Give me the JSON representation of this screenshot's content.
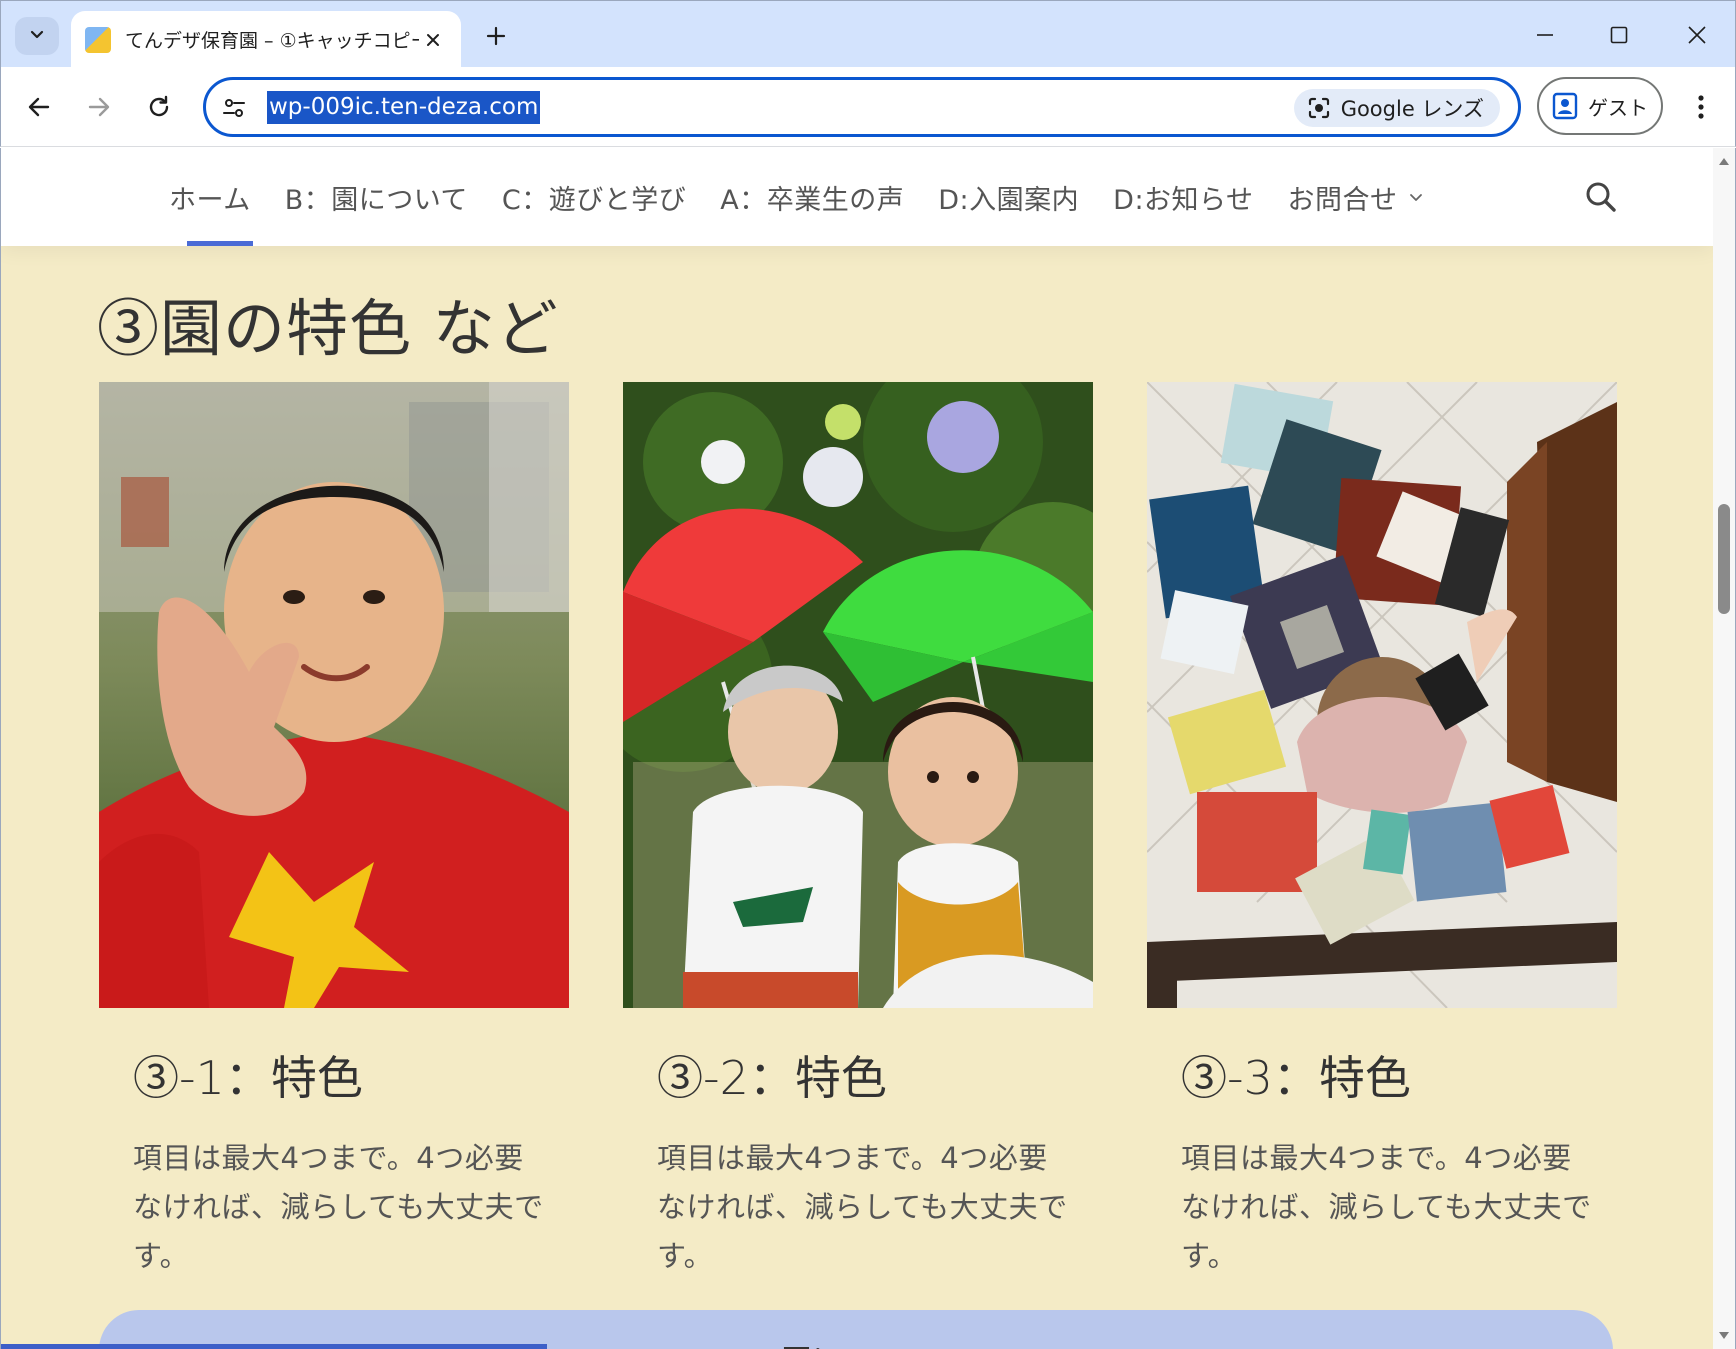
{
  "browser": {
    "tab_title": "てんデザ保育園 – ①キャッチコピー",
    "url": "wp-009ic.ten-deza.com",
    "lens_label": "Google レンズ",
    "profile_label": "ゲスト"
  },
  "site_nav": {
    "items": [
      {
        "label": "ホーム"
      },
      {
        "label": "B：園について"
      },
      {
        "label": "C：遊びと学び"
      },
      {
        "label": "A：卒業生の声"
      },
      {
        "label": "D:入園案内"
      },
      {
        "label": "D:お知らせ"
      },
      {
        "label": "お問合せ"
      }
    ]
  },
  "section": {
    "title": "③園の特色 など",
    "cards": [
      {
        "title": "③-1：特色",
        "text": "項目は最大4つまで。4つ必要なければ、減らしても大丈夫です。"
      },
      {
        "title": "③-2：特色",
        "text": "項目は最大4つまで。4つ必要なければ、減らしても大丈夫です。"
      },
      {
        "title": "③-3：特色",
        "text": "項目は最大4つまで。4つ必要なければ、減らしても大丈夫です。"
      }
    ]
  },
  "cta": {
    "label": "園について"
  },
  "colors": {
    "page_bg": "#f4ebc6",
    "accent": "#4a6bd6",
    "omnibox_border": "#0b57d0",
    "tabstrip": "#d3e3fd"
  },
  "icons": {
    "tab_search": "chevron-down-icon",
    "back": "arrow-left-icon",
    "forward": "arrow-right-icon",
    "reload": "reload-icon",
    "site_info": "tune-icon",
    "site_search": "search-icon"
  }
}
